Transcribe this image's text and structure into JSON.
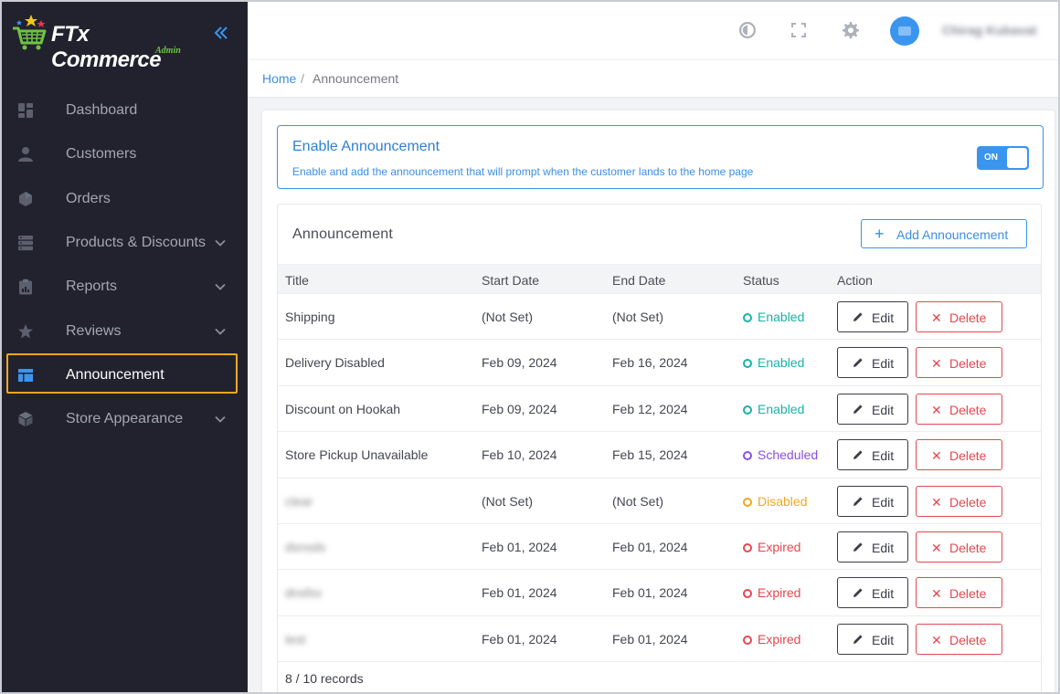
{
  "brand": {
    "name": "FTx Commerce",
    "sub": "Admin"
  },
  "sidebar": {
    "items": [
      {
        "label": "Dashboard",
        "icon": "dashboard-icon",
        "chevron": false,
        "active": false
      },
      {
        "label": "Customers",
        "icon": "user-icon",
        "chevron": false,
        "active": false
      },
      {
        "label": "Orders",
        "icon": "box-icon",
        "chevron": false,
        "active": false
      },
      {
        "label": "Products & Discounts",
        "icon": "server-icon",
        "chevron": true,
        "active": false
      },
      {
        "label": "Reports",
        "icon": "clipboard-icon",
        "chevron": true,
        "active": false
      },
      {
        "label": "Reviews",
        "icon": "star-icon",
        "chevron": true,
        "active": false
      },
      {
        "label": "Announcement",
        "icon": "layout-icon",
        "chevron": false,
        "active": true
      },
      {
        "label": "Store Appearance",
        "icon": "cube-icon",
        "chevron": true,
        "active": false
      }
    ]
  },
  "header": {
    "user_name": "Chirag Kubavat"
  },
  "breadcrumb": {
    "home": "Home",
    "separator": "/",
    "current": "Announcement"
  },
  "enable": {
    "title": "Enable Announcement",
    "description": "Enable and add the announcement that will prompt when the customer lands to the home page",
    "toggle_label": "ON"
  },
  "panel": {
    "title": "Announcement",
    "add_label": "Add Announcement",
    "columns": [
      "Title",
      "Start Date",
      "End Date",
      "Status",
      "Action"
    ],
    "rows": [
      {
        "title": "Shipping",
        "start": "(Not Set)",
        "end": "(Not Set)",
        "status": "Enabled",
        "blurred": false
      },
      {
        "title": "Delivery Disabled",
        "start": "Feb 09, 2024",
        "end": "Feb 16, 2024",
        "status": "Enabled",
        "blurred": false
      },
      {
        "title": "Discount on Hookah",
        "start": "Feb 09, 2024",
        "end": "Feb 12, 2024",
        "status": "Enabled",
        "blurred": false
      },
      {
        "title": "Store Pickup Unavailable",
        "start": "Feb 10, 2024",
        "end": "Feb 15, 2024",
        "status": "Scheduled",
        "blurred": false
      },
      {
        "title": "clear",
        "start": "(Not Set)",
        "end": "(Not Set)",
        "status": "Disabled",
        "blurred": true
      },
      {
        "title": "dsnsds",
        "start": "Feb 01, 2024",
        "end": "Feb 01, 2024",
        "status": "Expired",
        "blurred": true
      },
      {
        "title": "dnsfsv",
        "start": "Feb 01, 2024",
        "end": "Feb 01, 2024",
        "status": "Expired",
        "blurred": true
      },
      {
        "title": "test",
        "start": "Feb 01, 2024",
        "end": "Feb 01, 2024",
        "status": "Expired",
        "blurred": true
      }
    ],
    "edit_label": "Edit",
    "delete_label": "Delete",
    "records": "8 / 10 records"
  },
  "status_colors": {
    "Enabled": "#17b3a8",
    "Scheduled": "#8a4fe0",
    "Disabled": "#f0a823",
    "Expired": "#e5474f"
  },
  "colors": {
    "accent": "#3a95ef",
    "sidebar": "#22222f",
    "active_outline": "#f0a823"
  }
}
